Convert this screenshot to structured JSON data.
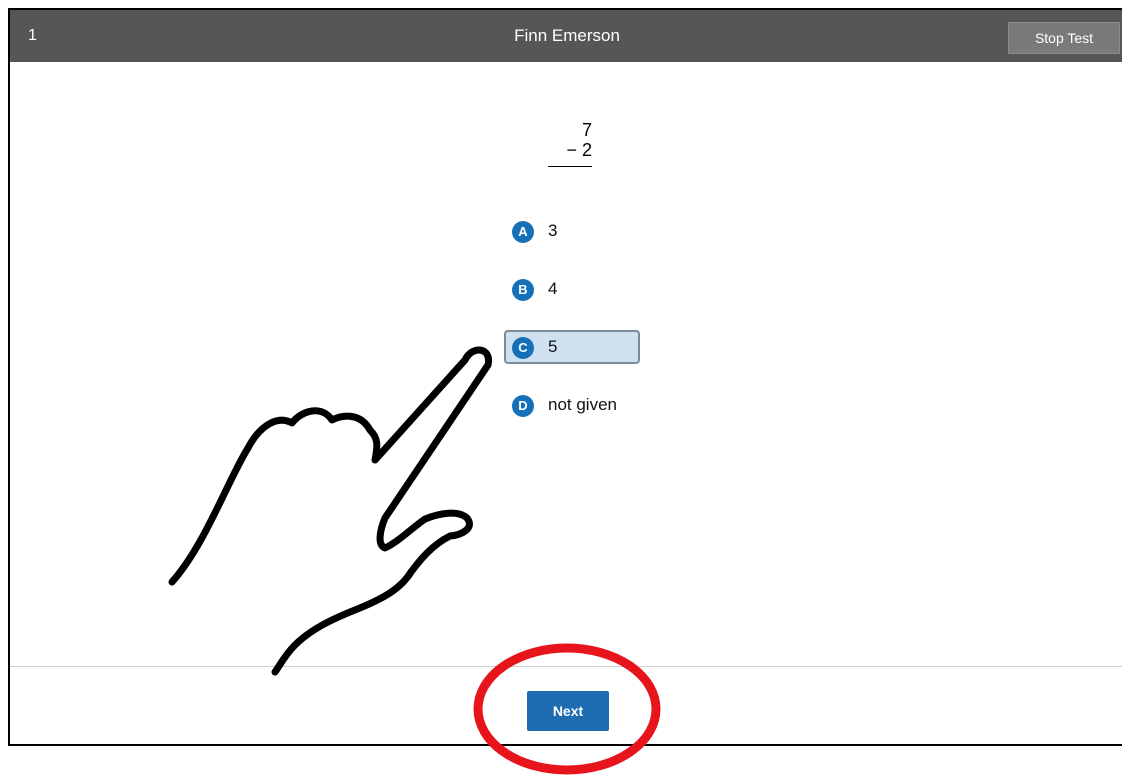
{
  "header": {
    "question_number": "1",
    "student_name": "Finn Emerson",
    "stop_label": "Stop Test"
  },
  "problem": {
    "top": "7",
    "bottom": "− 2"
  },
  "choices": [
    {
      "letter": "A",
      "text": "3",
      "selected": false
    },
    {
      "letter": "B",
      "text": "4",
      "selected": false
    },
    {
      "letter": "C",
      "text": "5",
      "selected": true
    },
    {
      "letter": "D",
      "text": "not given",
      "selected": false
    }
  ],
  "footer": {
    "next_label": "Next"
  },
  "colors": {
    "header_bg": "#565656",
    "accent": "#1570b8",
    "selected_bg": "#cfe1f1",
    "annotation": "#e8141c"
  },
  "annotations": {
    "hand": "pointing-hand-icon",
    "highlight": "red-circle-around-next"
  }
}
